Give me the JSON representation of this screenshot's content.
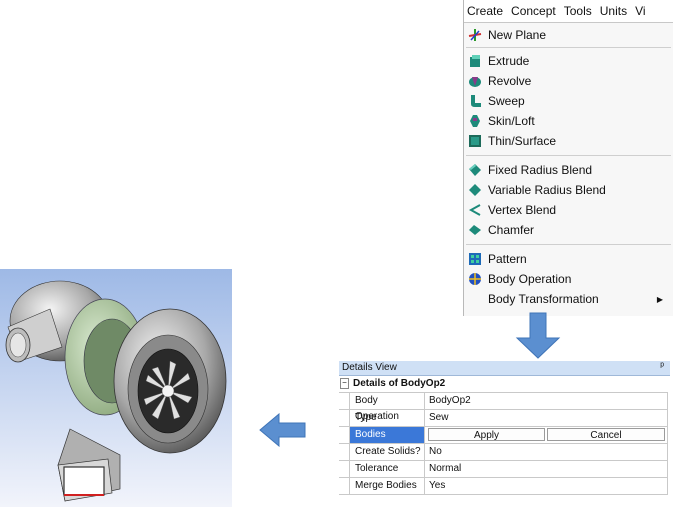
{
  "menubar": [
    "Create",
    "Concept",
    "Tools",
    "Units",
    "Vi"
  ],
  "menu_items": [
    {
      "label": "New Plane",
      "icon": "new-plane-icon"
    },
    {
      "label": "Extrude",
      "icon": "extrude-icon"
    },
    {
      "label": "Revolve",
      "icon": "revolve-icon"
    },
    {
      "label": "Sweep",
      "icon": "sweep-icon"
    },
    {
      "label": "Skin/Loft",
      "icon": "skin-loft-icon"
    },
    {
      "label": "Thin/Surface",
      "icon": "thin-surface-icon"
    },
    {
      "label": "Fixed Radius Blend",
      "icon": "fixed-radius-blend-icon"
    },
    {
      "label": "Variable Radius Blend",
      "icon": "variable-radius-blend-icon"
    },
    {
      "label": "Vertex Blend",
      "icon": "vertex-blend-icon"
    },
    {
      "label": "Chamfer",
      "icon": "chamfer-icon"
    },
    {
      "label": "Pattern",
      "icon": "pattern-icon"
    },
    {
      "label": "Body Operation",
      "icon": "body-operation-icon"
    },
    {
      "label": "Body Transformation",
      "icon": ""
    }
  ],
  "details": {
    "title": "Details View",
    "pin": "ᵖ",
    "group_title": "Details of BodyOp2",
    "collapse": "−",
    "rows": [
      {
        "label": "Body Operation",
        "value": "BodyOp2"
      },
      {
        "label": "Type",
        "value": "Sew"
      },
      {
        "label": "Bodies",
        "value": ""
      },
      {
        "label": "Create Solids?",
        "value": "No"
      },
      {
        "label": "Tolerance",
        "value": "Normal"
      },
      {
        "label": "Merge Bodies",
        "value": "Yes"
      }
    ],
    "apply_label": "Apply",
    "cancel_label": "Cancel"
  },
  "colors": {
    "selection": "#3b78d8",
    "arrow": "#5b8fd0",
    "viewport_top": "#9eb9e6",
    "viewport_bottom": "#f2f4fb"
  }
}
